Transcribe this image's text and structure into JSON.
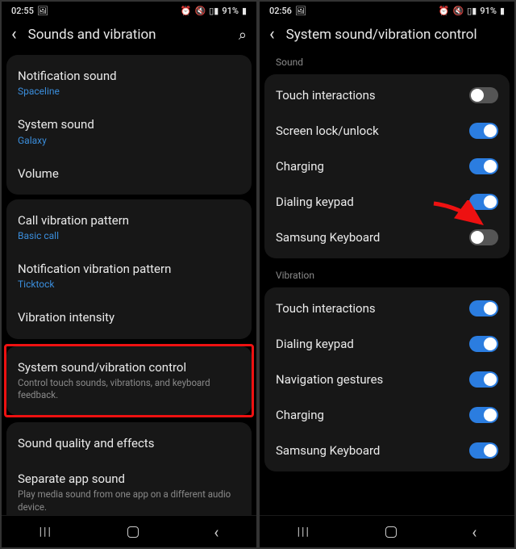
{
  "left": {
    "status": {
      "time": "02:55",
      "battery": "91%"
    },
    "header": {
      "title": "Sounds and vibration"
    },
    "group1": [
      {
        "title": "Notification sound",
        "sub": "Spaceline"
      },
      {
        "title": "System sound",
        "sub": "Galaxy"
      },
      {
        "title": "Volume"
      }
    ],
    "group2": [
      {
        "title": "Call vibration pattern",
        "sub": "Basic call"
      },
      {
        "title": "Notification vibration pattern",
        "sub": "Ticktock"
      },
      {
        "title": "Vibration intensity"
      }
    ],
    "highlight": {
      "title": "System sound/vibration control",
      "desc": "Control touch sounds, vibrations, and keyboard feedback."
    },
    "group3": [
      {
        "title": "Sound quality and effects"
      },
      {
        "title": "Separate app sound",
        "desc": "Play media sound from one app on a different audio device."
      }
    ]
  },
  "right": {
    "status": {
      "time": "02:56",
      "battery": "91%"
    },
    "header": {
      "title": "System sound/vibration control"
    },
    "sound_label": "Sound",
    "sound_rows": [
      {
        "title": "Touch interactions",
        "state": "off"
      },
      {
        "title": "Screen lock/unlock",
        "state": "on"
      },
      {
        "title": "Charging",
        "state": "on"
      },
      {
        "title": "Dialing keypad",
        "state": "on"
      },
      {
        "title": "Samsung Keyboard",
        "state": "off"
      }
    ],
    "vibration_label": "Vibration",
    "vibration_rows": [
      {
        "title": "Touch interactions",
        "state": "on"
      },
      {
        "title": "Dialing keypad",
        "state": "on"
      },
      {
        "title": "Navigation gestures",
        "state": "on"
      },
      {
        "title": "Charging",
        "state": "on"
      },
      {
        "title": "Samsung Keyboard",
        "state": "on"
      }
    ]
  },
  "icons": {
    "image_icon": "🖼",
    "alarm": "⏰",
    "mute": "🔇",
    "signal": "▮",
    "search": "🔍"
  }
}
